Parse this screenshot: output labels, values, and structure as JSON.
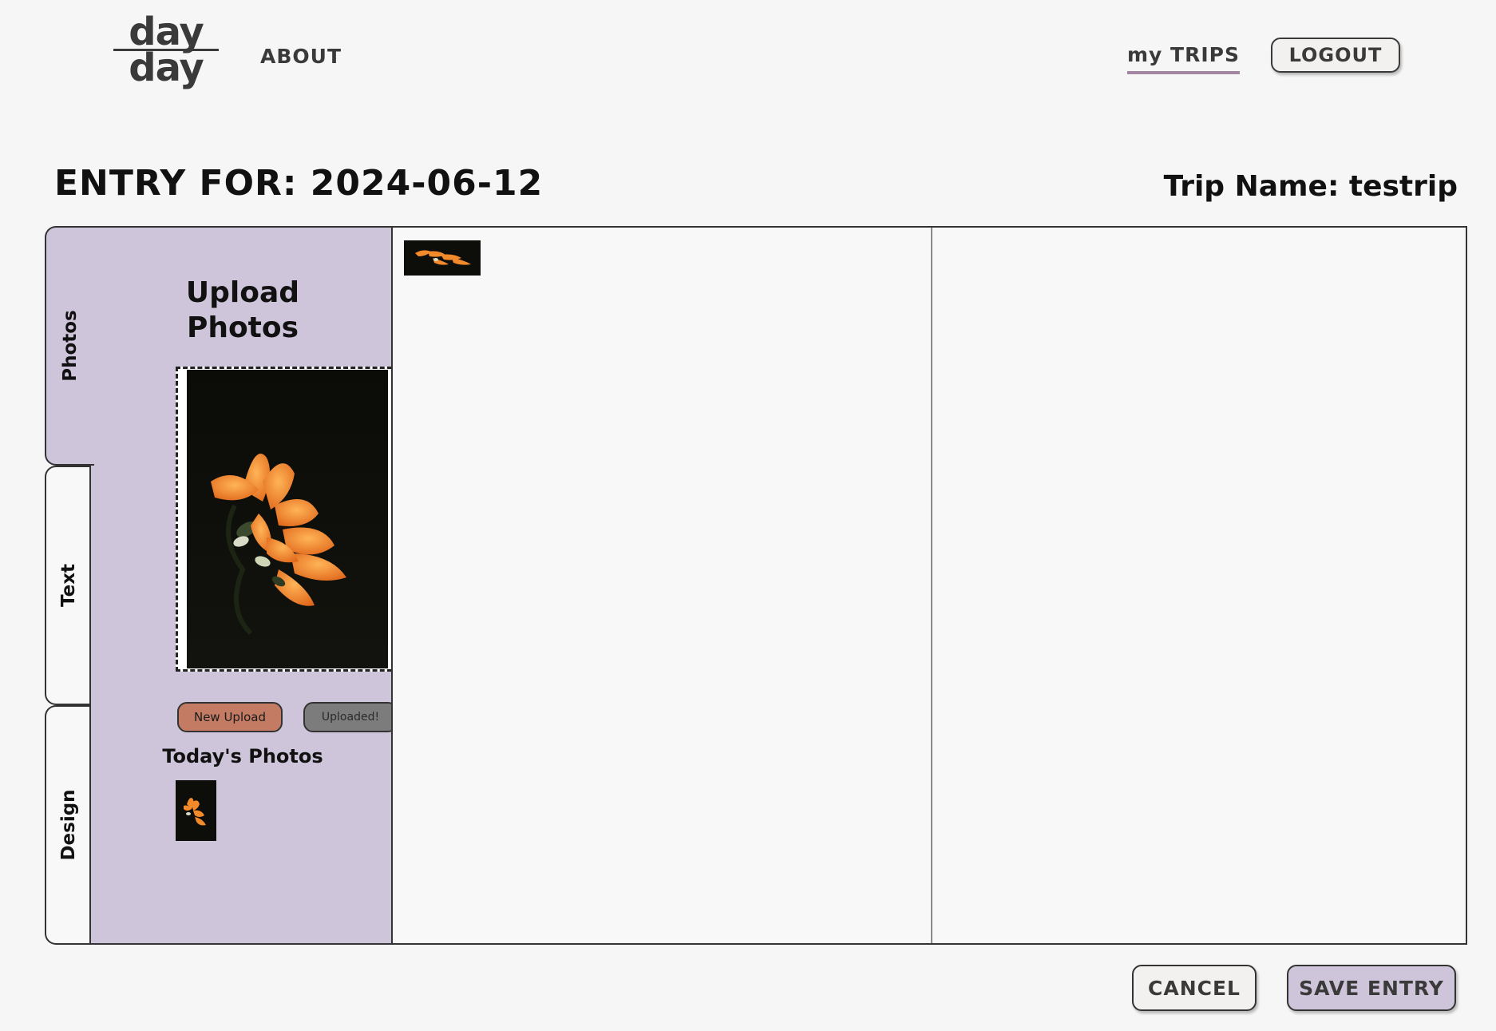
{
  "header": {
    "logo_top": "day",
    "logo_bottom": "day",
    "nav_about": "ABOUT",
    "nav_my_trips": "my TRIPS",
    "logout_label": "LOGOUT"
  },
  "entry": {
    "title": "ENTRY FOR: 2024-06-12",
    "trip_name": "Trip Name: testrip"
  },
  "tabs": [
    {
      "label": "Photos",
      "active": true
    },
    {
      "label": "Text",
      "active": false
    },
    {
      "label": "Design",
      "active": false
    }
  ],
  "photos_panel": {
    "title_line1": "Upload",
    "title_line2": "Photos",
    "new_upload_label": "New Upload",
    "uploaded_label": "Uploaded!",
    "todays_photos_label": "Today's Photos"
  },
  "footer": {
    "cancel_label": "CANCEL",
    "save_label": "SAVE ENTRY"
  },
  "colors": {
    "background": "#f6f6f6",
    "panel_lavender": "#cec5da",
    "accent_underline": "#a586a2",
    "new_upload_button": "#c47b63",
    "uploaded_button": "#7c7c7c",
    "text_dark": "#2a2a2a"
  },
  "icons": {
    "preview_image": "sunflower-photo",
    "today_thumb": "sunflower-thumbnail",
    "canvas_item": "sunflower-canvas-thumbnail"
  }
}
